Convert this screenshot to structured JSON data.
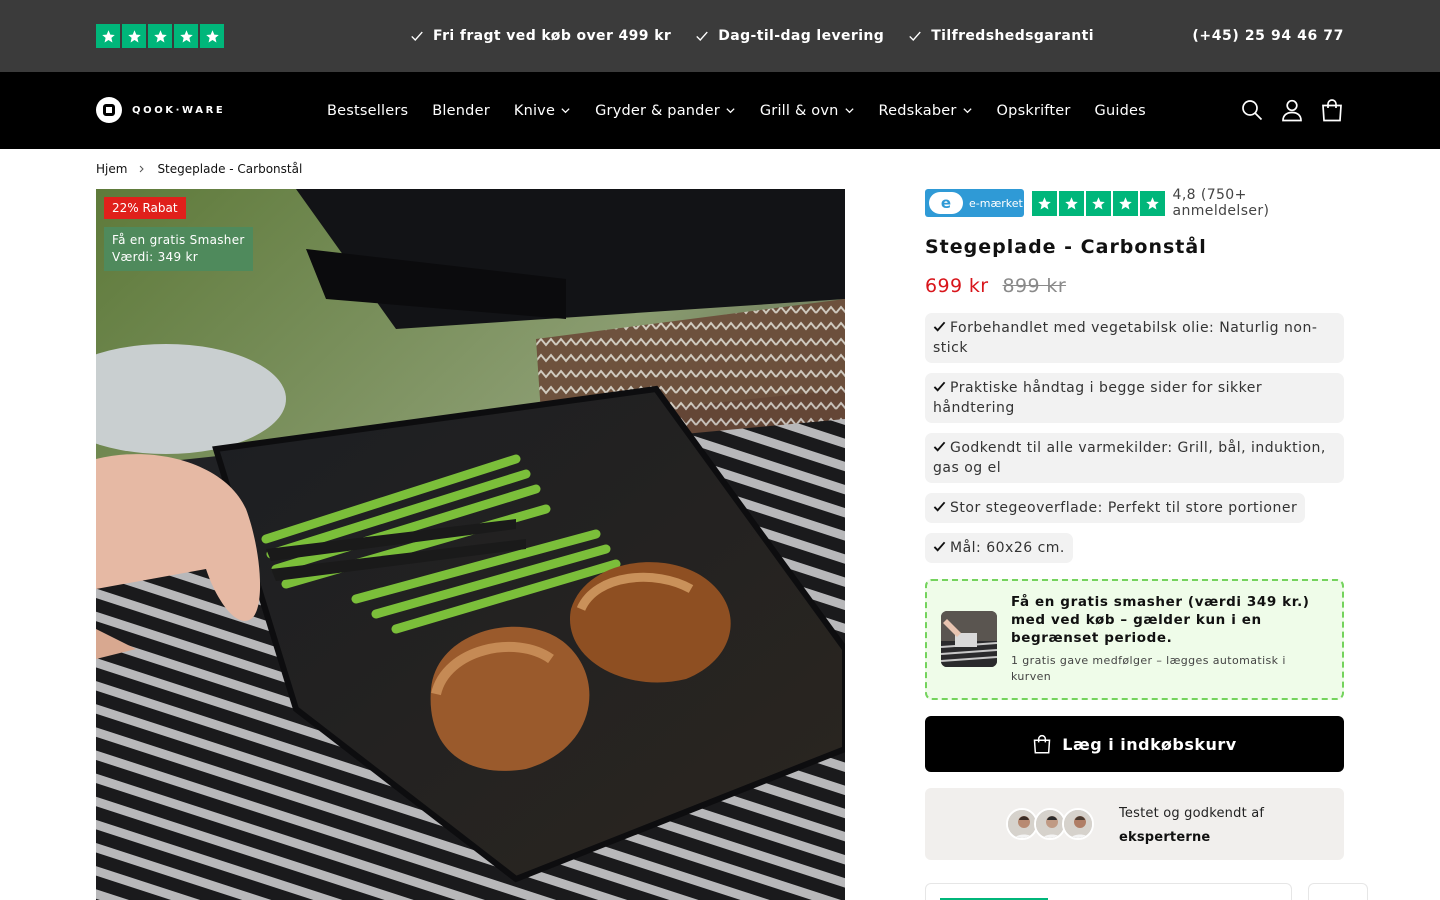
{
  "topbar": {
    "usps": [
      "Fri fragt ved køb over 499 kr",
      "Dag-til-dag levering",
      "Tilfredshedsgaranti"
    ],
    "phone": "(+45) 25 94 46 77"
  },
  "header": {
    "logo_text": "QOOK·WARE",
    "nav": [
      {
        "label": "Bestsellers",
        "dropdown": false
      },
      {
        "label": "Blender",
        "dropdown": false
      },
      {
        "label": "Knive",
        "dropdown": true
      },
      {
        "label": "Gryder & pander",
        "dropdown": true
      },
      {
        "label": "Grill & ovn",
        "dropdown": true
      },
      {
        "label": "Redskaber",
        "dropdown": true
      },
      {
        "label": "Opskrifter",
        "dropdown": false
      },
      {
        "label": "Guides",
        "dropdown": false
      }
    ],
    "icons": [
      "search-icon",
      "account-icon",
      "cart-icon"
    ]
  },
  "breadcrumb": {
    "home": "Hjem",
    "current": "Stegeplade - Carbonstål"
  },
  "image_badges": {
    "discount": "22% Rabat",
    "gift_line1": "Få en gratis Smasher",
    "gift_line2": "Værdi: 349 kr"
  },
  "product": {
    "emaerket_label": "e-mærket",
    "rating_text": "4,8 (750+ anmeldelser)",
    "rating_stars": 5,
    "title": "Stegeplade - Carbonstål",
    "price_now": "699 kr",
    "price_old": "899 kr",
    "features": [
      "Forbehandlet med vegetabilsk olie: Naturlig non-stick",
      "Praktiske håndtag i begge sider for sikker håndtering",
      "Godkendt til alle varmekilder: Grill, bål, induktion, gas og el",
      "Stor stegeoverflade: Perfekt til store portioner",
      "Mål: 60x26 cm."
    ],
    "gift_title": "Få en gratis smasher (værdi 349 kr.) med ved køb – gælder kun i en begrænset periode.",
    "gift_sub": "1 gratis gave medfølger – lægges automatisk i kurven",
    "add_to_cart": "Læg i indkøbskurv",
    "experts_line1": "Testet og godkendt af",
    "experts_line2": "eksperterne"
  },
  "colors": {
    "topbar_bg": "#3b3b3b",
    "header_bg": "#000000",
    "trustpilot_green": "#00b67a",
    "price_red": "#d8151b",
    "gift_bg": "#effce9",
    "gift_border": "#74d35d"
  }
}
